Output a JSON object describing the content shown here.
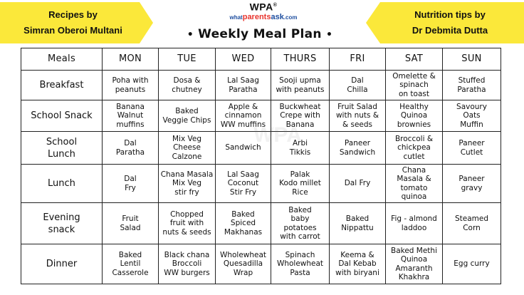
{
  "left_banner": {
    "line1": "Recipes by",
    "line2": "Simran Oberoi Multani"
  },
  "right_banner": {
    "line1": "Nutrition tips by",
    "line2": "Dr Debmita Dutta"
  },
  "logo": {
    "mark": "WPA",
    "registered": "®",
    "domain_a": "what",
    "domain_b": "parents",
    "domain_c": "ask",
    "domain_d": ".com"
  },
  "title": {
    "text": "Weekly Meal Plan",
    "bullet": "•"
  },
  "table": {
    "corner": "Meals",
    "days": [
      "MON",
      "TUE",
      "WED",
      "THURS",
      "FRI",
      "SAT",
      "SUN"
    ],
    "rows": [
      {
        "meal": [
          "Breakfast"
        ],
        "cells": [
          [
            "Poha with",
            "peanuts"
          ],
          [
            "Dosa &",
            "chutney"
          ],
          [
            "Lal Saag",
            "Paratha"
          ],
          [
            "Sooji upma",
            "with peanuts"
          ],
          [
            "Dal",
            "Chilla"
          ],
          [
            "Omelette &",
            "spinach",
            "on toast"
          ],
          [
            "Stuffed",
            "Paratha"
          ]
        ]
      },
      {
        "meal": [
          "School Snack"
        ],
        "cells": [
          [
            "Banana",
            "Walnut",
            "muffins"
          ],
          [
            "Baked",
            "Veggie Chips"
          ],
          [
            "Apple &",
            "cinnamon",
            "WW muffins"
          ],
          [
            "Buckwheat",
            "Crepe with",
            "Banana"
          ],
          [
            "Fruit Salad",
            "with nuts &",
            "& seeds"
          ],
          [
            "Healthy",
            "Quinoa",
            "brownies"
          ],
          [
            "Savoury",
            "Oats",
            "Muffin"
          ]
        ]
      },
      {
        "meal": [
          "School",
          "Lunch"
        ],
        "cells": [
          [
            "Dal",
            "Paratha"
          ],
          [
            "Mix Veg",
            "Cheese",
            "Calzone"
          ],
          [
            "Sandwich"
          ],
          [
            "Arbi",
            "Tikkis"
          ],
          [
            "Paneer",
            "Sandwich"
          ],
          [
            "Broccoli &",
            "chickpea",
            "cutlet"
          ],
          [
            "Paneer",
            "Cutlet"
          ]
        ]
      },
      {
        "meal": [
          "Lunch"
        ],
        "cells": [
          [
            "Dal",
            "Fry"
          ],
          [
            "Chana Masala",
            "Mix Veg",
            "stir fry"
          ],
          [
            "Lal Saag",
            "Coconut",
            "Stir Fry"
          ],
          [
            "Palak",
            "Kodo millet",
            "Rice"
          ],
          [
            "Dal Fry"
          ],
          [
            "Chana",
            "Masala &",
            "tomato",
            "quinoa"
          ],
          [
            "Paneer",
            "gravy"
          ]
        ]
      },
      {
        "meal": [
          "Evening",
          "snack"
        ],
        "cells": [
          [
            "Fruit",
            "Salad"
          ],
          [
            "Chopped",
            "fruit with",
            "nuts & seeds"
          ],
          [
            "Baked",
            "Spiced",
            "Makhanas"
          ],
          [
            "Baked",
            "baby",
            "potatoes",
            "with carrot"
          ],
          [
            "Baked",
            "Nippattu"
          ],
          [
            "Fig - almond",
            "laddoo"
          ],
          [
            "Steamed",
            "Corn"
          ]
        ]
      },
      {
        "meal": [
          "Dinner"
        ],
        "cells": [
          [
            "Baked",
            "Lentil",
            "Casserole"
          ],
          [
            "Black chana",
            "Broccoli",
            "WW burgers"
          ],
          [
            "Wholewheat",
            "Quesadilla",
            "Wrap"
          ],
          [
            "Spinach",
            "Wholewheat",
            "Pasta"
          ],
          [
            "Keema &",
            "Dal Kebab",
            "with biryani"
          ],
          [
            "Baked Methi",
            "Quinoa",
            "Amaranth",
            "Khakhra"
          ],
          [
            "Egg curry"
          ]
        ]
      }
    ]
  }
}
